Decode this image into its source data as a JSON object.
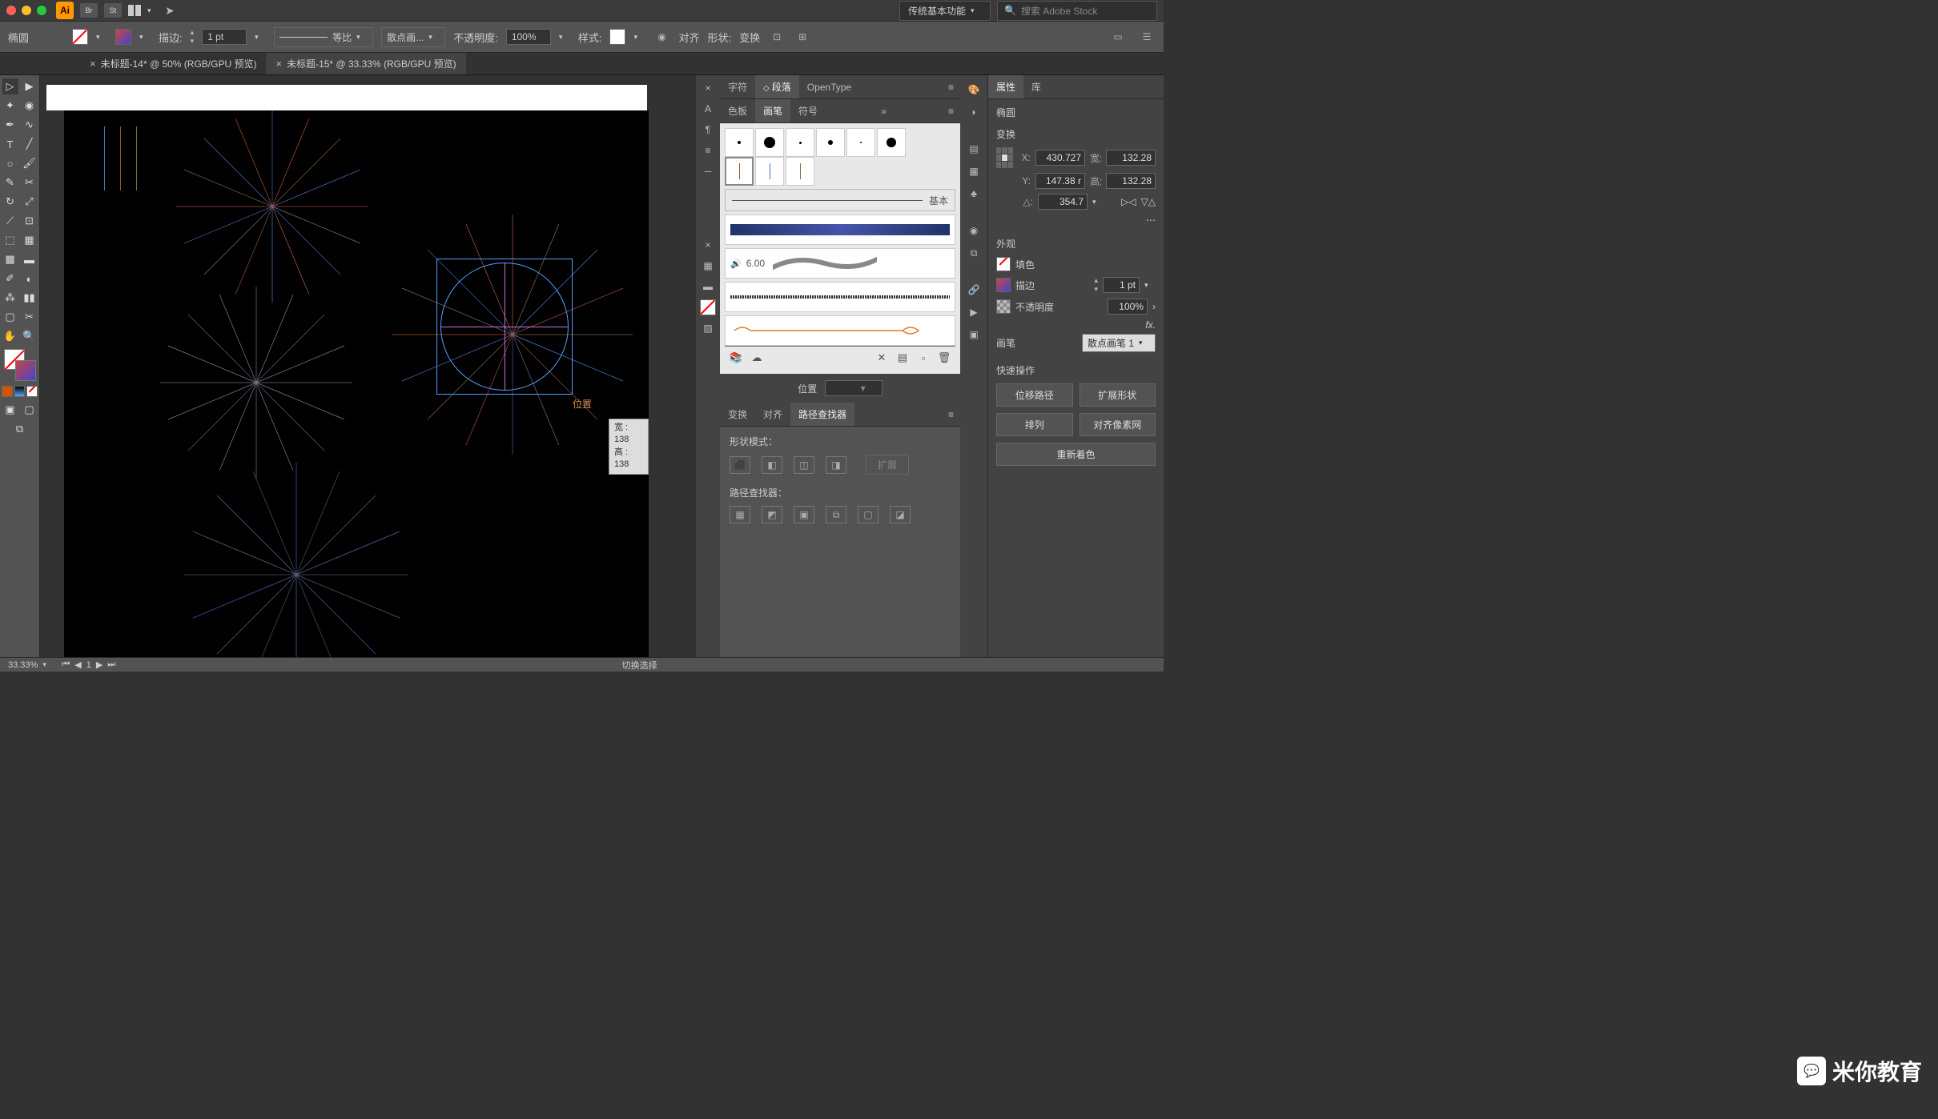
{
  "titlebar": {
    "ai": "Ai",
    "br": "Br",
    "st": "St",
    "workspace": "传统基本功能",
    "search_placeholder": "搜索 Adobe Stock"
  },
  "controlbar": {
    "shape": "椭圆",
    "stroke_label": "描边:",
    "stroke_weight": "1 pt",
    "profile": "等比",
    "brush_name": "散点画...",
    "opacity_label": "不透明度:",
    "opacity_value": "100%",
    "style_label": "样式:",
    "align": "对齐",
    "shape_btn": "形状:",
    "transform": "变换"
  },
  "tabs": [
    {
      "label": "未标题-14* @ 50% (RGB/GPU 预览)",
      "active": false
    },
    {
      "label": "未标题-15* @ 33.33% (RGB/GPU 预览)",
      "active": true
    }
  ],
  "canvas": {
    "pos_label": "位置",
    "tip_w": "宽 : 138",
    "tip_h": "高 : 138"
  },
  "char_panel": {
    "char": "字符",
    "para": "段落",
    "opentype": "OpenType"
  },
  "brush_panel": {
    "swatches": "色板",
    "brushes": "画笔",
    "symbols": "符号",
    "basic": "基本",
    "cal_value": "6.00"
  },
  "position_panel": {
    "label": "位置"
  },
  "pathfinder": {
    "transform": "变换",
    "align": "对齐",
    "pathfinder": "路径查找器",
    "shape_modes": "形状模式：",
    "expand": "扩展",
    "pathfinders": "路径查找器："
  },
  "properties": {
    "props_tab": "属性",
    "lib_tab": "库",
    "object": "椭圆",
    "transform_header": "变换",
    "x_label": "X:",
    "x_val": "430.727",
    "y_label": "Y:",
    "y_val": "147.38 r",
    "w_label": "宽:",
    "w_val": "132.28",
    "h_label": "高:",
    "h_val": "132.28",
    "angle_label": "△:",
    "angle_val": "354.7",
    "appearance_header": "外观",
    "fill_label": "填色",
    "stroke_label": "描边",
    "stroke_val": "1 pt",
    "opacity_label": "不透明度",
    "opacity_val": "100%",
    "brush_label": "画笔",
    "brush_val": "散点画笔 1",
    "quick_header": "快速操作",
    "offset_path": "位移路径",
    "expand_shape": "扩展形状",
    "arrange": "排列",
    "align_pixel": "对齐像素网",
    "recolor": "重新着色"
  },
  "statusbar": {
    "zoom": "33.33%",
    "nav": "1",
    "mode": "切换选择"
  },
  "watermark": "米你教育"
}
